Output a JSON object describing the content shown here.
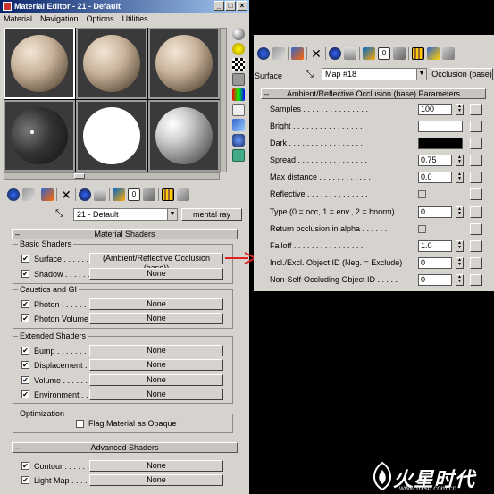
{
  "window": {
    "title": "Material Editor - 21 - Default"
  },
  "menu": {
    "items": [
      "Material",
      "Navigation",
      "Options",
      "Utilities"
    ]
  },
  "left_panel": {
    "material_name": "21 - Default",
    "type_button": "mental ray",
    "rollout_material_shaders": "Material Shaders",
    "rollout_advanced_shaders": "Advanced Shaders",
    "groups": {
      "basic": "Basic Shaders",
      "caustics": "Caustics and GI",
      "extended": "Extended Shaders",
      "optimization": "Optimization"
    },
    "basic_rows": [
      {
        "label": "Surface . . . . . .",
        "value": "(Ambient/Reflective Occlusion (base))"
      },
      {
        "label": "Shadow . . . . . .",
        "value": "None"
      }
    ],
    "caustics_rows": [
      {
        "label": "Photon . . . . . .",
        "value": "None"
      },
      {
        "label": "Photon Volume . .",
        "value": "None"
      }
    ],
    "extended_rows": [
      {
        "label": "Bump . . . . . . .",
        "value": "None"
      },
      {
        "label": "Displacement . . .",
        "value": "None"
      },
      {
        "label": "Volume . . . . . .",
        "value": "None"
      },
      {
        "label": "Environment . . . .",
        "value": "None"
      }
    ],
    "optimization_label": "Flag Material as Opaque",
    "advanced_rows": [
      {
        "label": "Contour . . . . . .",
        "value": "None"
      },
      {
        "label": "Light Map . . . . .",
        "value": "None"
      }
    ]
  },
  "right_panel": {
    "surface_label": "Surface",
    "map_name": "Map #18",
    "type_button": "Occlusion (base)",
    "rollout": "Ambient/Reflective Occlusion (base) Parameters",
    "params": [
      {
        "label": "Samples . . . . . . . . . . . . . . .",
        "value": "100",
        "kind": "spin"
      },
      {
        "label": "Bright . . . . . . . . . . . . . . . .",
        "value": "#ffffff",
        "kind": "swatch"
      },
      {
        "label": "Dark . . . . . . . . . . . . . . . . .",
        "value": "#000000",
        "kind": "swatch"
      },
      {
        "label": "Spread . . . . . . . . . . . . . . . .",
        "value": "0.75",
        "kind": "spin"
      },
      {
        "label": "Max distance . . . . . . . . . . . .",
        "value": "0.0",
        "kind": "spin"
      },
      {
        "label": "Reflective . . . . . . . . . . . . . .",
        "value": "",
        "kind": "check"
      },
      {
        "label": "Type (0 = occ, 1 = env., 2 = bnorm)",
        "value": "0",
        "kind": "spin"
      },
      {
        "label": "Return occlusion in alpha . . . . . .",
        "value": "",
        "kind": "check"
      },
      {
        "label": "Falloff . . . . . . . . . . . . . . . .",
        "value": "1.0",
        "kind": "spin"
      },
      {
        "label": "Incl./Excl. Object ID (Neg. = Exclude)",
        "value": "0",
        "kind": "spin"
      },
      {
        "label": "Non-Self-Occluding Object ID . . . . .",
        "value": "0",
        "kind": "spin"
      }
    ]
  },
  "watermark": {
    "logo_text": "火星时代",
    "url": "www.hxsd.com.cn"
  },
  "colors": {
    "titlebar": "#0a246a",
    "panel": "#d6d3ce",
    "arrow": "#e02020"
  }
}
